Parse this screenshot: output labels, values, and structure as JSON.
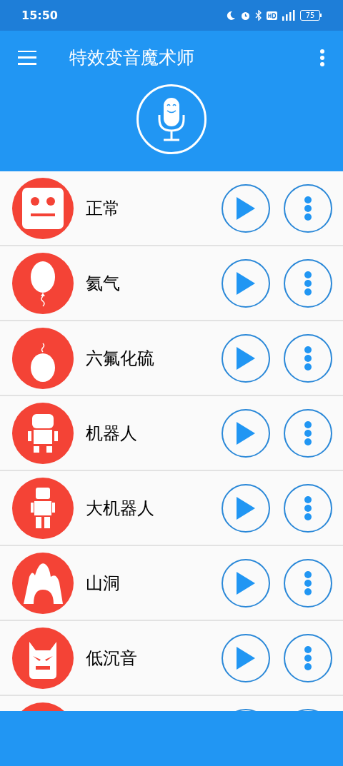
{
  "status_bar": {
    "time": "15:50",
    "battery": "75"
  },
  "app_bar": {
    "title": "特效变音魔术师"
  },
  "effects": [
    {
      "kind": "face",
      "label": "正常"
    },
    {
      "kind": "balloon",
      "label": "氦气"
    },
    {
      "kind": "heavy_balloon",
      "label": "六氟化硫"
    },
    {
      "kind": "robot",
      "label": "机器人"
    },
    {
      "kind": "tall_robot",
      "label": "大机器人"
    },
    {
      "kind": "cave",
      "label": "山洞"
    },
    {
      "kind": "mask",
      "label": "低沉音"
    },
    {
      "kind": "hidden"
    }
  ]
}
